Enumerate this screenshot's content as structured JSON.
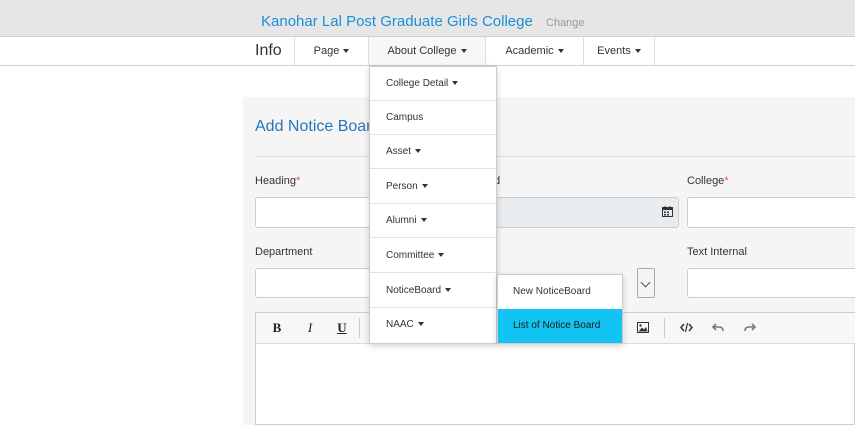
{
  "header": {
    "college_name": "Kanohar Lal Post Graduate Girls College",
    "change_label": "Change"
  },
  "navbar": {
    "brand": "Info",
    "items": [
      {
        "label": "Page"
      },
      {
        "label": "About College"
      },
      {
        "label": "Academic"
      },
      {
        "label": "Events"
      }
    ]
  },
  "form": {
    "title": "Add Notice Boar",
    "heading_label": "Heading",
    "date_label_partial": "d",
    "college_label": "College",
    "department_label": "Department",
    "text_internal_label": "Text Internal",
    "required_mark": "*"
  },
  "editor_toolbar": {
    "bold": "B",
    "italic": "I",
    "underline": "U"
  },
  "about_menu": {
    "items": [
      {
        "label": "College Detail",
        "has_caret": true
      },
      {
        "label": "Campus",
        "has_caret": false
      },
      {
        "label": "Asset",
        "has_caret": true
      },
      {
        "label": "Person",
        "has_caret": true
      },
      {
        "label": "Alumni",
        "has_caret": true
      },
      {
        "label": "Committee",
        "has_caret": true
      },
      {
        "label": "NoticeBoard",
        "has_caret": true
      },
      {
        "label": "NAAC",
        "has_caret": true
      }
    ]
  },
  "noticeboard_submenu": {
    "items": [
      {
        "label": "New NoticeBoard",
        "active": false
      },
      {
        "label": "List of Notice Board",
        "active": true
      }
    ]
  },
  "colors": {
    "accent": "#12c4f1",
    "link": "#1a8fd8",
    "title": "#2a75b8",
    "required": "#d9534f"
  }
}
